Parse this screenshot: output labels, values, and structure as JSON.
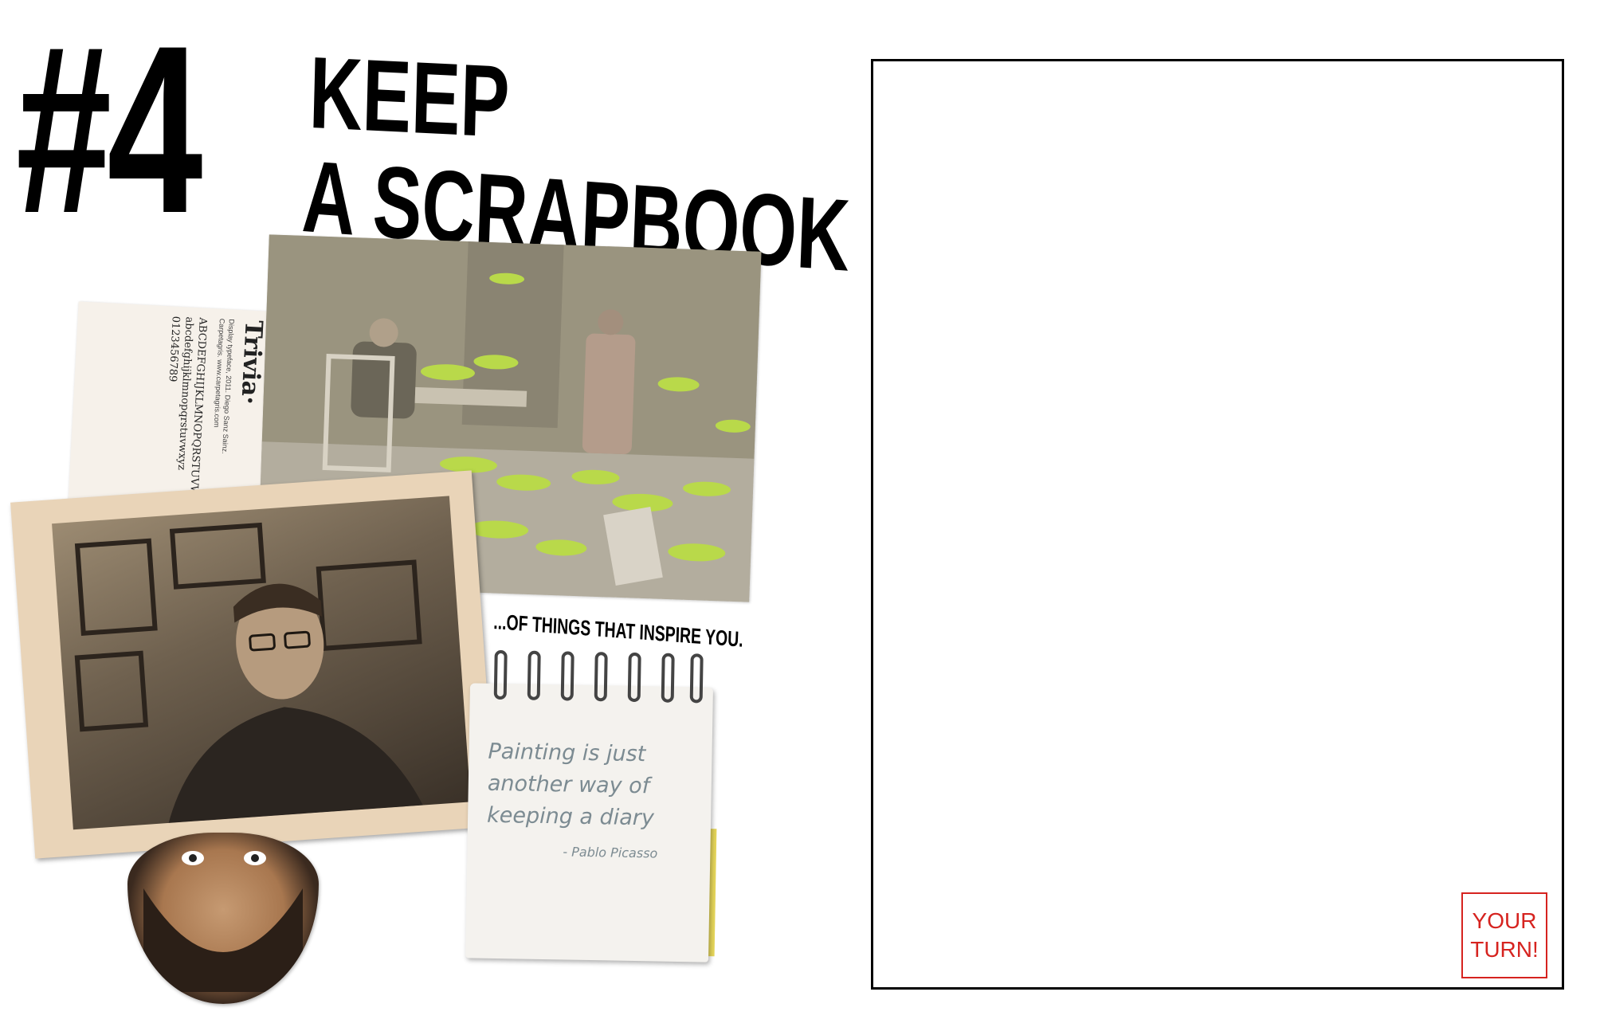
{
  "heading": {
    "number": "#4",
    "title_line_1": "KEEP",
    "title_line_2": "A SCRAPBOOK"
  },
  "caption": "...OF THINGS THAT INSPIRE YOU.",
  "type_card": {
    "specimen": "Trivia·",
    "credit_1": "Display typeface, 2011. Diego Sanz Sainz.",
    "credit_2": "Carpetagris. www.carpetagris.com",
    "body": "ABCDEFGHIJKLMNOPQRSTUVWXYZ abcdefghijklmnopqrstuvwxyz 0123456789"
  },
  "notepad": {
    "line_1": "Painting is just",
    "line_2": "another way of",
    "line_3": "keeping a diary",
    "attribution": "- Pablo Picasso"
  },
  "badge": {
    "line_1": "YOUR",
    "line_2": "TURN!"
  },
  "colors": {
    "accent_red": "#d6231f",
    "figurine_green": "#b9d94a",
    "sepia": "#e9d4b8"
  }
}
